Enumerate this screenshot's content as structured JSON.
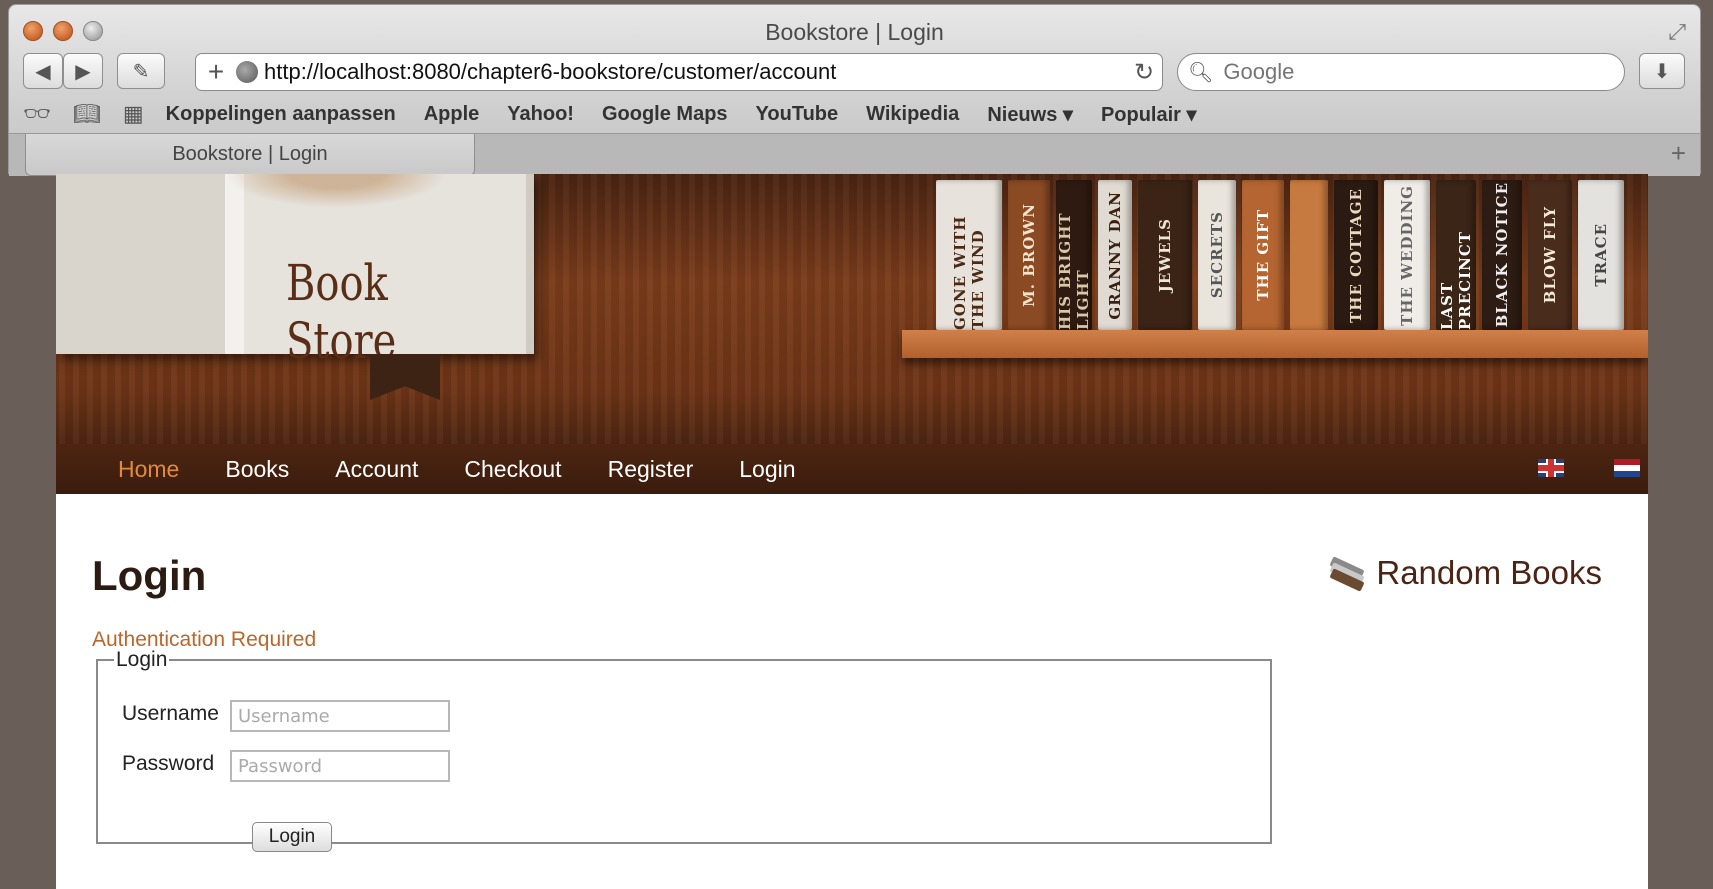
{
  "browser": {
    "window_title": "Bookstore | Login",
    "url": "http://localhost:8080/chapter6-bookstore/customer/account",
    "search_placeholder": "Google",
    "bookmarks": [
      "Koppelingen aanpassen",
      "Apple",
      "Yahoo!",
      "Google Maps",
      "YouTube",
      "Wikipedia",
      "Nieuws ▾",
      "Populair ▾"
    ],
    "tab_title": "Bookstore | Login"
  },
  "header": {
    "logo_text": "Book Store",
    "book_spines": [
      "GONE WITH THE WIND",
      "M. BROWN",
      "HIS BRIGHT LIGHT",
      "GRANNY DAN",
      "JEWELS",
      "SECRETS",
      "THE GIFT",
      "",
      "THE COTTAGE",
      "THE WEDDING",
      "LAST PRECINCT",
      "BLACK NOTICE",
      "BLOW FLY",
      "TRACE"
    ],
    "nav": [
      "Home",
      "Books",
      "Account",
      "Checkout",
      "Register",
      "Login"
    ],
    "active_nav": "Home"
  },
  "main": {
    "title": "Login",
    "message": "Authentication Required",
    "fieldset_legend": "Login",
    "username_label": "Username",
    "username_placeholder": "Username",
    "password_label": "Password",
    "password_placeholder": "Password",
    "submit_label": "Login"
  },
  "sidebar": {
    "title": "Random Books"
  },
  "colors": {
    "accent": "#e0893f",
    "message": "#b9672a",
    "nav_bg": "#3a1c0d"
  }
}
